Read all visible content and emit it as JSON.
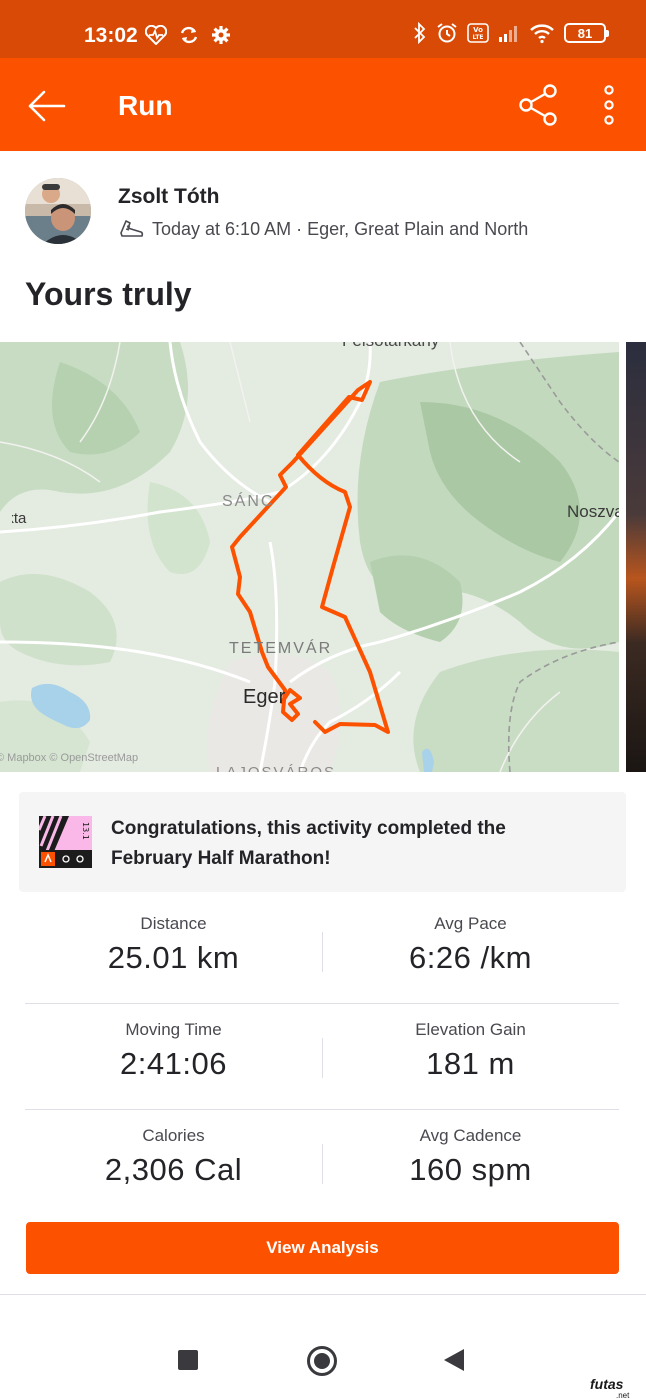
{
  "status_bar": {
    "time": "13:02",
    "battery": "81",
    "left_icons": [
      "heart-rate-icon",
      "sync-icon",
      "settings-gear-icon"
    ],
    "right_icons": [
      "bluetooth-icon",
      "alarm-icon",
      "volte-icon",
      "signal-icon",
      "wifi-icon",
      "battery-icon"
    ]
  },
  "app_bar": {
    "title": "Run",
    "back_icon": "arrow-left-icon",
    "share_icon": "share-icon",
    "more_icon": "more-vertical-icon"
  },
  "athlete": {
    "name": "Zsolt Tóth",
    "meta": "Today at 6:10 AM · Eger, Great Plain and North",
    "sport_icon": "run-shoe-icon"
  },
  "activity": {
    "title": "Yours truly"
  },
  "map": {
    "labels": {
      "top": "Felsőtárkány",
      "left": "akta",
      "right": "Noszva",
      "sanc": "SÁNC",
      "tetemvar": "TETEMVÁR",
      "eger": "Eger",
      "bottom": "LAJOSVÁROS",
      "attribution": "© Mapbox © OpenStreetMap"
    },
    "route_color": "#fc5200"
  },
  "challenge": {
    "text": "Congratulations, this activity completed the February Half Marathon!",
    "badge_label": "13.1"
  },
  "stats": [
    {
      "left": {
        "label": "Distance",
        "value": "25.01 km"
      },
      "right": {
        "label": "Avg Pace",
        "value": "6:26 /km"
      }
    },
    {
      "left": {
        "label": "Moving Time",
        "value": "2:41:06"
      },
      "right": {
        "label": "Elevation Gain",
        "value": "181 m"
      }
    },
    {
      "left": {
        "label": "Calories",
        "value": "2,306 Cal"
      },
      "right": {
        "label": "Avg Cadence",
        "value": "160 spm"
      }
    }
  ],
  "actions": {
    "view_analysis": "View Analysis"
  },
  "watermark": {
    "brand": "futas",
    "suffix": ".net"
  },
  "colors": {
    "status_bar": "#d84a06",
    "brand": "#fc5200",
    "text": "#242428"
  }
}
